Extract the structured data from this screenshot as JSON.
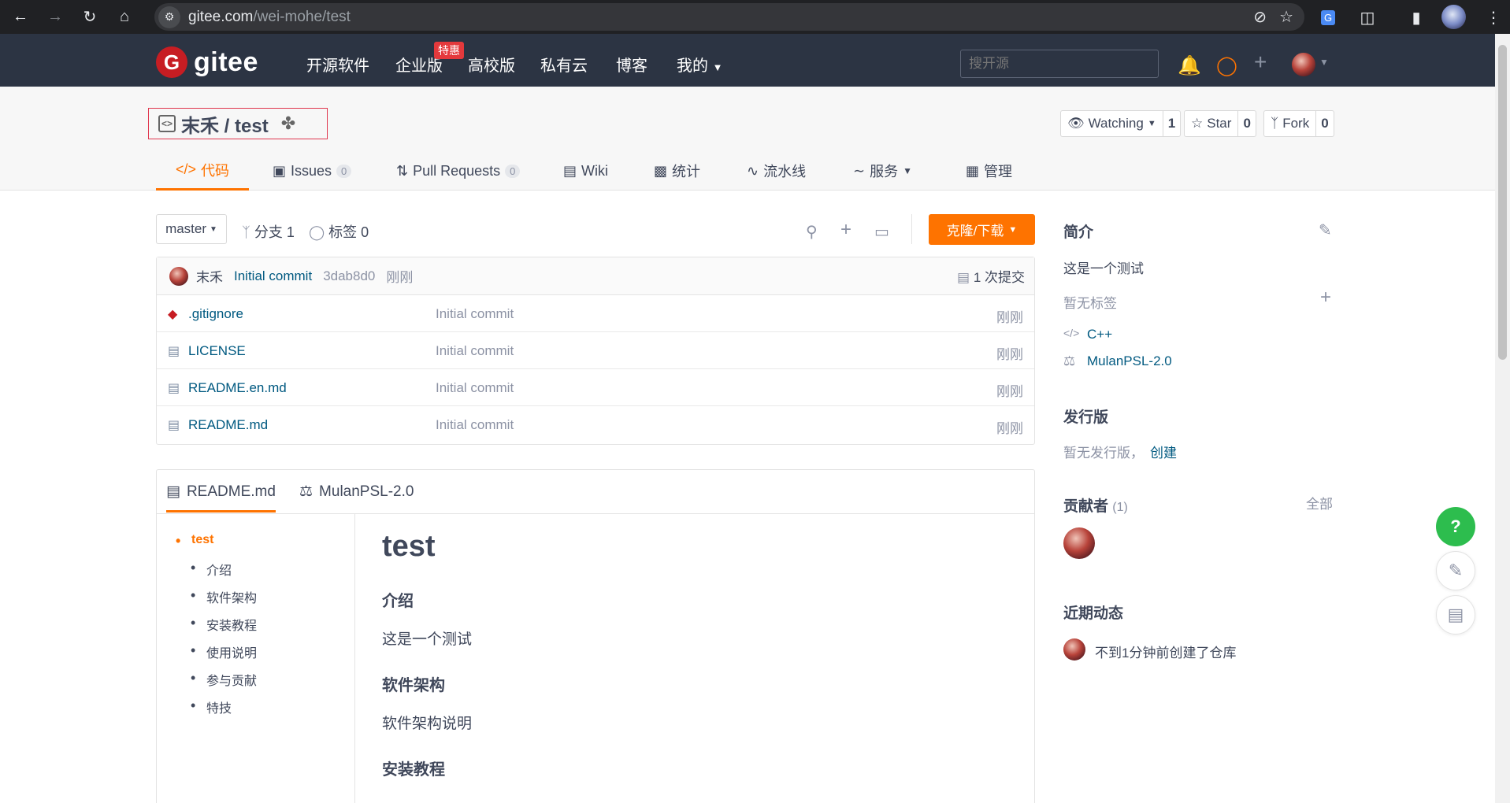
{
  "browser": {
    "url_host": "gitee.com",
    "url_path": "/wei-mohe/test"
  },
  "header": {
    "logo_text": "gitee",
    "nav": [
      "开源软件",
      "企业版",
      "高校版",
      "私有云",
      "博客",
      "我的"
    ],
    "promo_badge": "特惠",
    "search_placeholder": "搜开源"
  },
  "repo": {
    "title": "末禾 / test",
    "watching_label": "Watching",
    "watching_count": "1",
    "star_label": "Star",
    "star_count": "0",
    "fork_label": "Fork",
    "fork_count": "0",
    "tabs": [
      {
        "label": "代码"
      },
      {
        "label": "Issues",
        "count": "0"
      },
      {
        "label": "Pull Requests",
        "count": "0"
      },
      {
        "label": "Wiki"
      },
      {
        "label": "统计"
      },
      {
        "label": "流水线"
      },
      {
        "label": "服务"
      },
      {
        "label": "管理"
      }
    ]
  },
  "toolbar": {
    "branch": "master",
    "branches": "分支 1",
    "tags": "标签 0",
    "clone_label": "克隆/下载"
  },
  "commit": {
    "author": "末禾",
    "message": "Initial commit",
    "hash": "3dab8d0",
    "time": "刚刚",
    "count_label": "1 次提交"
  },
  "files": [
    {
      "name": ".gitignore",
      "message": "Initial commit",
      "time": "刚刚",
      "icon": "git-icon"
    },
    {
      "name": "LICENSE",
      "message": "Initial commit",
      "time": "刚刚",
      "icon": "book-icon"
    },
    {
      "name": "README.en.md",
      "message": "Initial commit",
      "time": "刚刚",
      "icon": "book-icon"
    },
    {
      "name": "README.md",
      "message": "Initial commit",
      "time": "刚刚",
      "icon": "book-icon"
    }
  ],
  "readme": {
    "tabs": [
      "README.md",
      "MulanPSL-2.0"
    ],
    "toc": [
      "test",
      "介绍",
      "软件架构",
      "安装教程",
      "使用说明",
      "参与贡献",
      "特技"
    ],
    "h1": "test",
    "sections": [
      {
        "title": "介绍",
        "text": "这是一个测试"
      },
      {
        "title": "软件架构",
        "text": "软件架构说明"
      },
      {
        "title": "安装教程",
        "text": ""
      }
    ]
  },
  "sidebar": {
    "intro_title": "简介",
    "intro_text": "这是一个测试",
    "no_tags": "暂无标签",
    "language": "C++",
    "license": "MulanPSL-2.0",
    "release_title": "发行版",
    "no_release": "暂无发行版，",
    "create_link": "创建",
    "contributors_title": "贡献者",
    "contributors_count": "(1)",
    "all_link": "全部",
    "activity_title": "近期动态",
    "activity_text": "不到1分钟前创建了仓库"
  },
  "colors": {
    "accent": "#fe7300",
    "header_bg": "#2c3443",
    "logo_red": "#c71d23",
    "help_green": "#2dbd4e"
  }
}
